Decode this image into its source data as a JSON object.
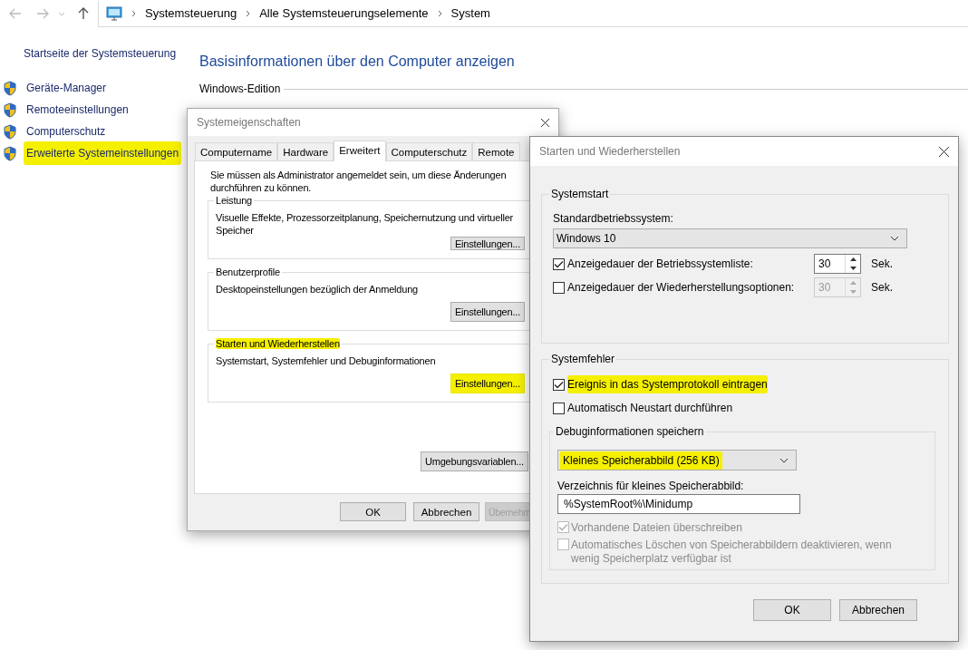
{
  "explorer": {
    "breadcrumbs": [
      "Systemsteuerung",
      "Alle Systemsteuerungselemente",
      "System"
    ]
  },
  "sidebar": {
    "home_link": "Startseite der Systemsteuerung",
    "items": [
      {
        "label": "Geräte-Manager",
        "highlighted": false
      },
      {
        "label": "Remoteeinstellungen",
        "highlighted": false
      },
      {
        "label": "Computerschutz",
        "highlighted": false
      },
      {
        "label": "Erweiterte Systemeinstellungen",
        "highlighted": true
      }
    ]
  },
  "main": {
    "heading": "Basisinformationen über den Computer anzeigen",
    "section": "Windows-Edition"
  },
  "system_properties": {
    "title": "Systemeigenschaften",
    "tabs": [
      {
        "label": "Computername",
        "selected": false
      },
      {
        "label": "Hardware",
        "selected": false
      },
      {
        "label": "Erweitert",
        "selected": true
      },
      {
        "label": "Computerschutz",
        "selected": false
      },
      {
        "label": "Remote",
        "selected": false
      }
    ],
    "note": "Sie müssen als Administrator angemeldet sein, um diese Änderungen durchführen zu können.",
    "groups": [
      {
        "title": "Leistung",
        "title_highlighted": false,
        "text": "Visuelle Effekte, Prozessorzeitplanung, Speichernutzung und virtueller Speicher",
        "button": {
          "label": "Einstellungen...",
          "highlighted": false
        }
      },
      {
        "title": "Benutzerprofile",
        "title_highlighted": false,
        "text": "Desktopeinstellungen bezüglich der Anmeldung",
        "button": {
          "label": "Einstellungen...",
          "highlighted": false
        }
      },
      {
        "title": "Starten und Wiederherstellen",
        "title_highlighted": true,
        "text": "Systemstart, Systemfehler und Debuginformationen",
        "button": {
          "label": "Einstellungen...",
          "highlighted": true
        }
      }
    ],
    "env_button": "Umgebungsvariablen...",
    "buttons": [
      {
        "label": "OK",
        "disabled": false
      },
      {
        "label": "Abbrechen",
        "disabled": false
      },
      {
        "label": "Übernehm",
        "disabled": true
      }
    ]
  },
  "startup_recovery": {
    "title": "Starten und Wiederherstellen",
    "systemstart": {
      "title": "Systemstart",
      "os_label": "Standardbetriebssystem:",
      "os_value": "Windows 10",
      "rows": [
        {
          "label": "Anzeigedauer der Betriebssystemliste:",
          "checked": true,
          "value": "30",
          "disabled": false,
          "unit": "Sek."
        },
        {
          "label": "Anzeigedauer der Wiederherstellungsoptionen:",
          "checked": false,
          "value": "30",
          "disabled": true,
          "unit": "Sek."
        }
      ]
    },
    "systemfehler": {
      "title": "Systemfehler",
      "checks": [
        {
          "label": "Ereignis in das Systemprotokoll eintragen",
          "checked": true,
          "highlighted": true
        },
        {
          "label": "Automatisch Neustart durchführen",
          "checked": false,
          "highlighted": false
        }
      ],
      "debug": {
        "title": "Debuginformationen speichern",
        "dropdown": {
          "value": "Kleines Speicherabbild (256 KB)",
          "highlighted": true
        },
        "dir_label": "Verzeichnis für kleines Speicherabbild:",
        "dir_value": "%SystemRoot%\\Minidump",
        "options": [
          {
            "label": "Vorhandene Dateien überschreiben",
            "checked": true,
            "disabled": true
          },
          {
            "label": "Automatisches Löschen von Speicherabbildern deaktivieren, wenn wenig Speicherplatz verfügbar ist",
            "checked": false,
            "disabled": true
          }
        ]
      }
    },
    "buttons": [
      "OK",
      "Abbrechen"
    ]
  }
}
